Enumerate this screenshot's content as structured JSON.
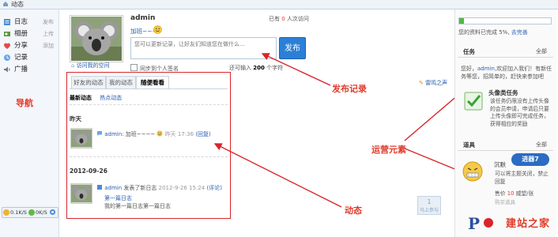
{
  "breadcrumb": {
    "label": "动态"
  },
  "sidebar": {
    "items": [
      {
        "label": "日志",
        "action": "发布",
        "icon": "log-icon"
      },
      {
        "label": "相册",
        "action": "上传",
        "icon": "album-icon"
      },
      {
        "label": "分享",
        "action": "添加",
        "icon": "share-icon"
      },
      {
        "label": "记录",
        "action": "",
        "icon": "record-icon"
      },
      {
        "label": "广播",
        "action": "",
        "icon": "broadcast-icon"
      }
    ],
    "annotation": "导航",
    "status": {
      "up": "0.1K/S",
      "down": "0K/S"
    }
  },
  "profile": {
    "username": "admin",
    "visits_prefix": "已有",
    "visits_count": "0",
    "visits_suffix": "人次访问",
    "status_text": "加班~~~~",
    "visit_space": "访问我的空间"
  },
  "composer": {
    "placeholder": "您可以更新记录，让好友们知道您在做什么...",
    "publish_label": "发布",
    "sync_label": "同步到个人签名",
    "char_prefix": "还可输入",
    "char_count": "200",
    "char_suffix": "个字符",
    "annotation": "发布记录"
  },
  "feed": {
    "tabs": [
      "好友的动态",
      "我的动态",
      "随便看看"
    ],
    "active_tab": "随便看看",
    "subtabs": [
      "最新动态",
      "热点动态"
    ],
    "groups": [
      {
        "date": "昨天",
        "entries": [
          {
            "user": "admin",
            "text": ": 加班~~~~",
            "time": "昨天 17:36",
            "reply": "(回复)"
          }
        ]
      },
      {
        "date": "2012-09-26",
        "entries": [
          {
            "user": "admin",
            "action": "发表了新日志",
            "time": "2012-9-26 15:24",
            "comment": "(评论)",
            "title": "第一篇日志",
            "body": "我的第一篇日志第一篇日志"
          }
        ]
      }
    ],
    "annotation": "动态",
    "pager": {
      "page": "1",
      "label": "马上参与"
    }
  },
  "voice": {
    "label": "雷鸣之声"
  },
  "right": {
    "progress": {
      "percent": 5,
      "text_prefix": "您的资料已完成 5%,",
      "link": "去完善"
    },
    "tasks": {
      "title": "任务",
      "more": "全部",
      "intro_prefix": "您好，",
      "intro_name": "admin",
      "intro_rest": ",欢迎加入我们！有新任务等您，招简单的，赶快来参加吧",
      "task_title": "头像类任务",
      "task_body": "该任务仍限没有上传头像的会员申请，申请后只要上传头像即可完成任务，获得相应的奖励"
    },
    "items": {
      "title": "道具",
      "more": "全部",
      "name": "沉默",
      "badge": "进器7",
      "body": "可以将主题关闭，禁止回复",
      "price_prefix": "售价",
      "price_value": "10",
      "price_suffix": "威望/张",
      "more_link": "购买道具"
    },
    "annotation": "运营元素",
    "watermark": "建站之家"
  },
  "colors": {
    "accent": "#2c7fd6",
    "annotation": "#e03a2a",
    "progress": "#4dbb3c",
    "frame": "#d9252a"
  }
}
